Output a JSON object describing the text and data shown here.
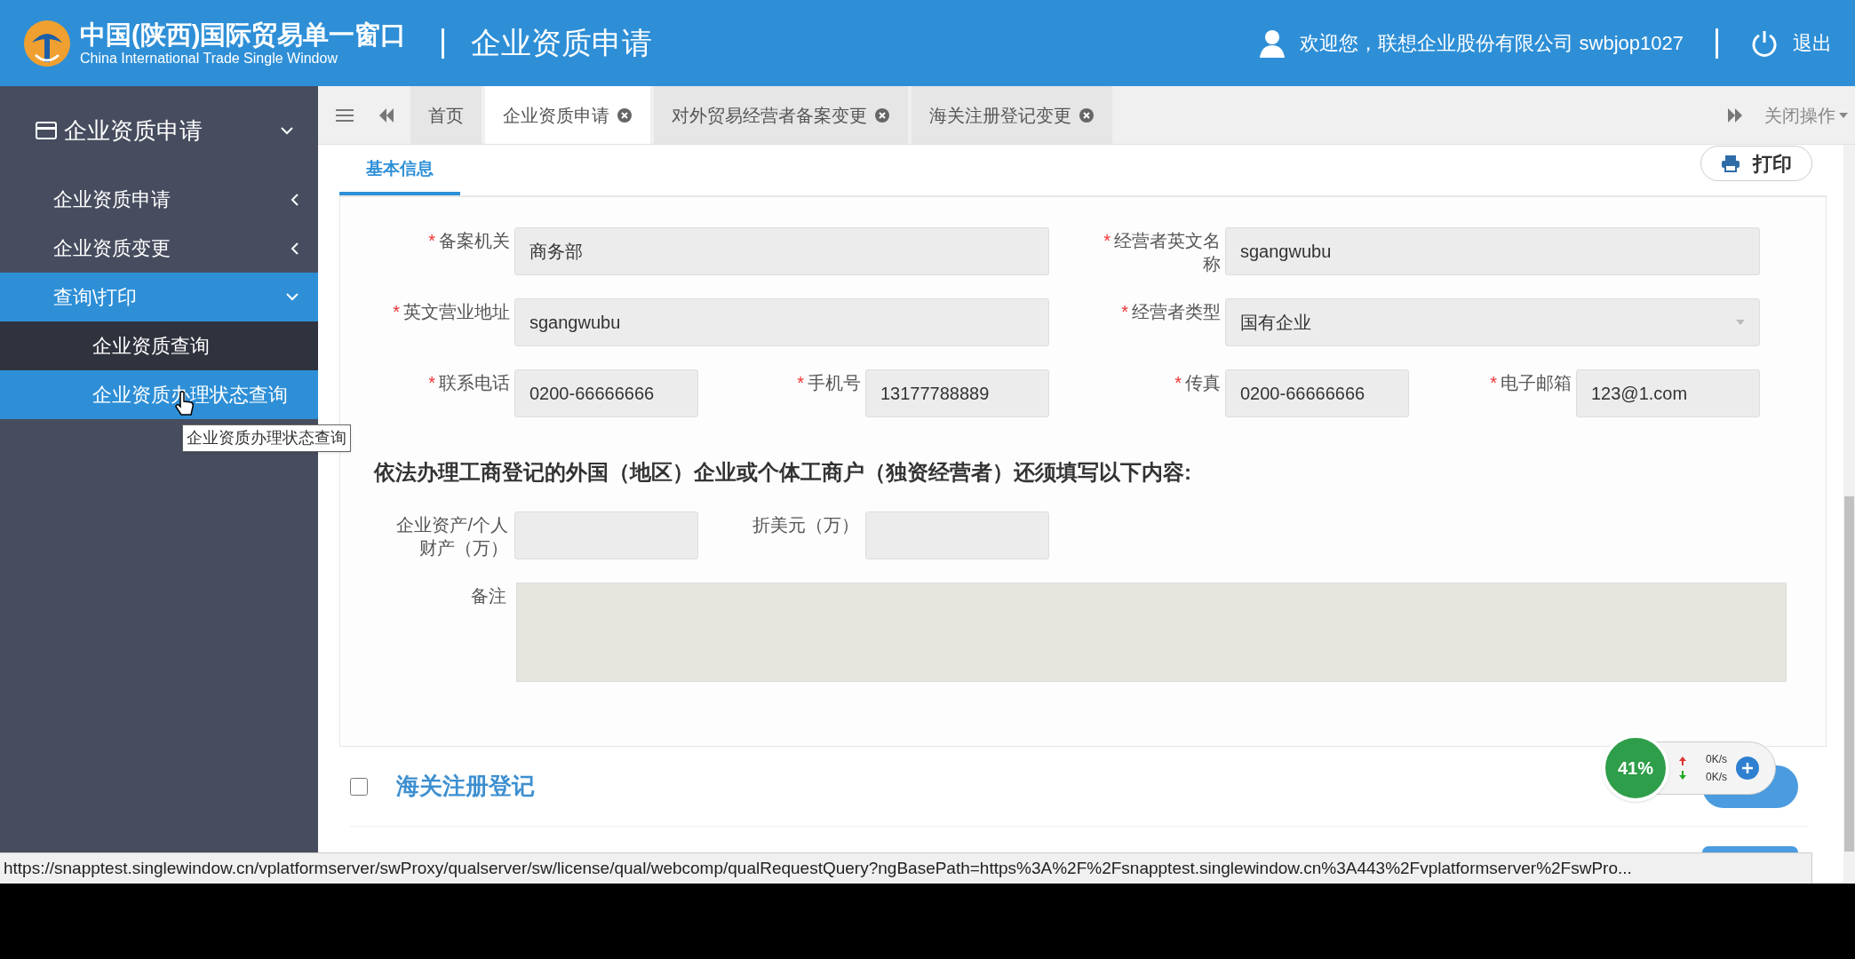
{
  "header": {
    "title": "中国(陕西)国际贸易单一窗口",
    "subtitle": "China International Trade Single Window",
    "page_title": "企业资质申请",
    "welcome": "欢迎您，联想企业股份有限公司 swbjop1027",
    "logout": "退出"
  },
  "sidebar": {
    "heading": "企业资质申请",
    "items": [
      {
        "label": "企业资质申请",
        "expanded": false,
        "selected": false
      },
      {
        "label": "企业资质变更",
        "expanded": false,
        "selected": false
      },
      {
        "label": "查询\\打印",
        "expanded": true,
        "selected": true,
        "children": [
          {
            "label": "企业资质查询",
            "selected": false
          },
          {
            "label": "企业资质办理状态查询",
            "selected": true
          }
        ]
      }
    ]
  },
  "tooltip": "企业资质办理状态查询",
  "tabs": [
    {
      "label": "首页",
      "closable": false,
      "selected": false
    },
    {
      "label": "企业资质申请",
      "closable": true,
      "selected": true
    },
    {
      "label": "对外贸易经营者备案变更",
      "closable": true,
      "selected": false
    },
    {
      "label": "海关注册登记变更",
      "closable": true,
      "selected": false
    }
  ],
  "close_menu": "关闭操作",
  "section_tab": "基本信息",
  "print_button": "打印",
  "form_rows": [
    [
      {
        "required_mark": "*",
        "label": "备案机关",
        "value": "商务部",
        "kind": "text"
      },
      {
        "required_mark": "*",
        "label": "经营者英文名称",
        "value": "sgangwubu",
        "kind": "text"
      }
    ],
    [
      {
        "required_mark": "*",
        "label": "英文营业地址",
        "value": "sgangwubu",
        "kind": "text"
      },
      {
        "required_mark": "*",
        "label": "经营者类型",
        "value": "国有企业",
        "kind": "select"
      }
    ],
    [
      {
        "required_mark": "*",
        "label": "联系电话",
        "value": "0200-66666666",
        "kind": "text"
      },
      {
        "required_mark": "*",
        "label": "手机号",
        "value": "13177788889",
        "kind": "text"
      },
      {
        "required_mark": "*",
        "label": "传真",
        "value": "0200-66666666",
        "kind": "text"
      },
      {
        "required_mark": "*",
        "label": "电子邮箱",
        "value": "123@1.com",
        "kind": "text"
      }
    ]
  ],
  "foreign_heading": "依法办理工商登记的外国（地区）企业或个体工商户（独资经营者）还须填写以下内容:",
  "foreign_fields": [
    {
      "label": "企业资产/个人财产（万）"
    },
    {
      "label": "折美元（万）"
    }
  ],
  "remark_label": "备注",
  "customs_section": {
    "label": "海关注册登记",
    "checked": false
  },
  "network_widget": {
    "percent": "41%",
    "upload": "0K/s",
    "download": "0K/s"
  },
  "status_url": "https://snapptest.singlewindow.cn/vplatformserver/swProxy/qualserver/sw/license/qual/webcomp/qualRequestQuery?ngBasePath=https%3A%2F%2Fsnapptest.singlewindow.cn%3A443%2Fvplatformserver%2FswPro..."
}
